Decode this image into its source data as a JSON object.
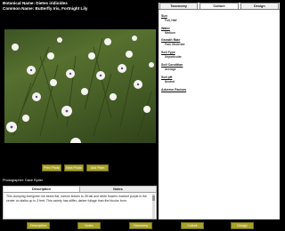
{
  "header": {
    "botanical_name": "Botanical Name: Dietes iridioides",
    "common_name": "Common Name: Butterfly Iris, Fortnight Lily"
  },
  "photo": {
    "alt": "Butterfly Iris plants with white flowers"
  },
  "photo_actions": {
    "prev_label": "Prev Photo",
    "next_label": "Next Photo",
    "add_label": "Add Plant"
  },
  "photographer": "Photographer: Dave Ryder",
  "description_panel": {
    "tabs": [
      {
        "label": "Description",
        "active": true
      },
      {
        "label": "Notes",
        "active": false
      }
    ],
    "text": "This clumping evergreen iris bears flat, narrow leaves to 2ft tall and white flowers marked purple in the center on stalks up to 3 feet. This variety has stiffer, darker foliage than the bicolor form."
  },
  "detail_panel": {
    "tabs": [
      {
        "label": "Taxonomy",
        "active": false
      },
      {
        "label": "Culture",
        "active": true
      },
      {
        "label": "Design",
        "active": false
      }
    ],
    "attributes": [
      {
        "label": "Sun",
        "value": "Full, Half"
      },
      {
        "label": "Water",
        "value": "Medium"
      },
      {
        "label": "Growth Rate",
        "value": "Fast, Moderate"
      },
      {
        "label": "Soil Type",
        "value": "Unparticular"
      },
      {
        "label": "Soil Condition",
        "value": "Average"
      },
      {
        "label": "Soil pH",
        "value": "Neutral"
      },
      {
        "label": "Adverse Factors",
        "value": ""
      }
    ]
  },
  "bottom_nav": [
    {
      "label": "Description"
    },
    {
      "label": "Notes"
    },
    {
      "label": "Taxonomy"
    },
    {
      "label": "Culture"
    },
    {
      "label": "Design"
    }
  ],
  "colors": {
    "background": "#000000",
    "button": "#a7a22a",
    "panel": "#ffffff",
    "foliage": "#4a6228"
  }
}
